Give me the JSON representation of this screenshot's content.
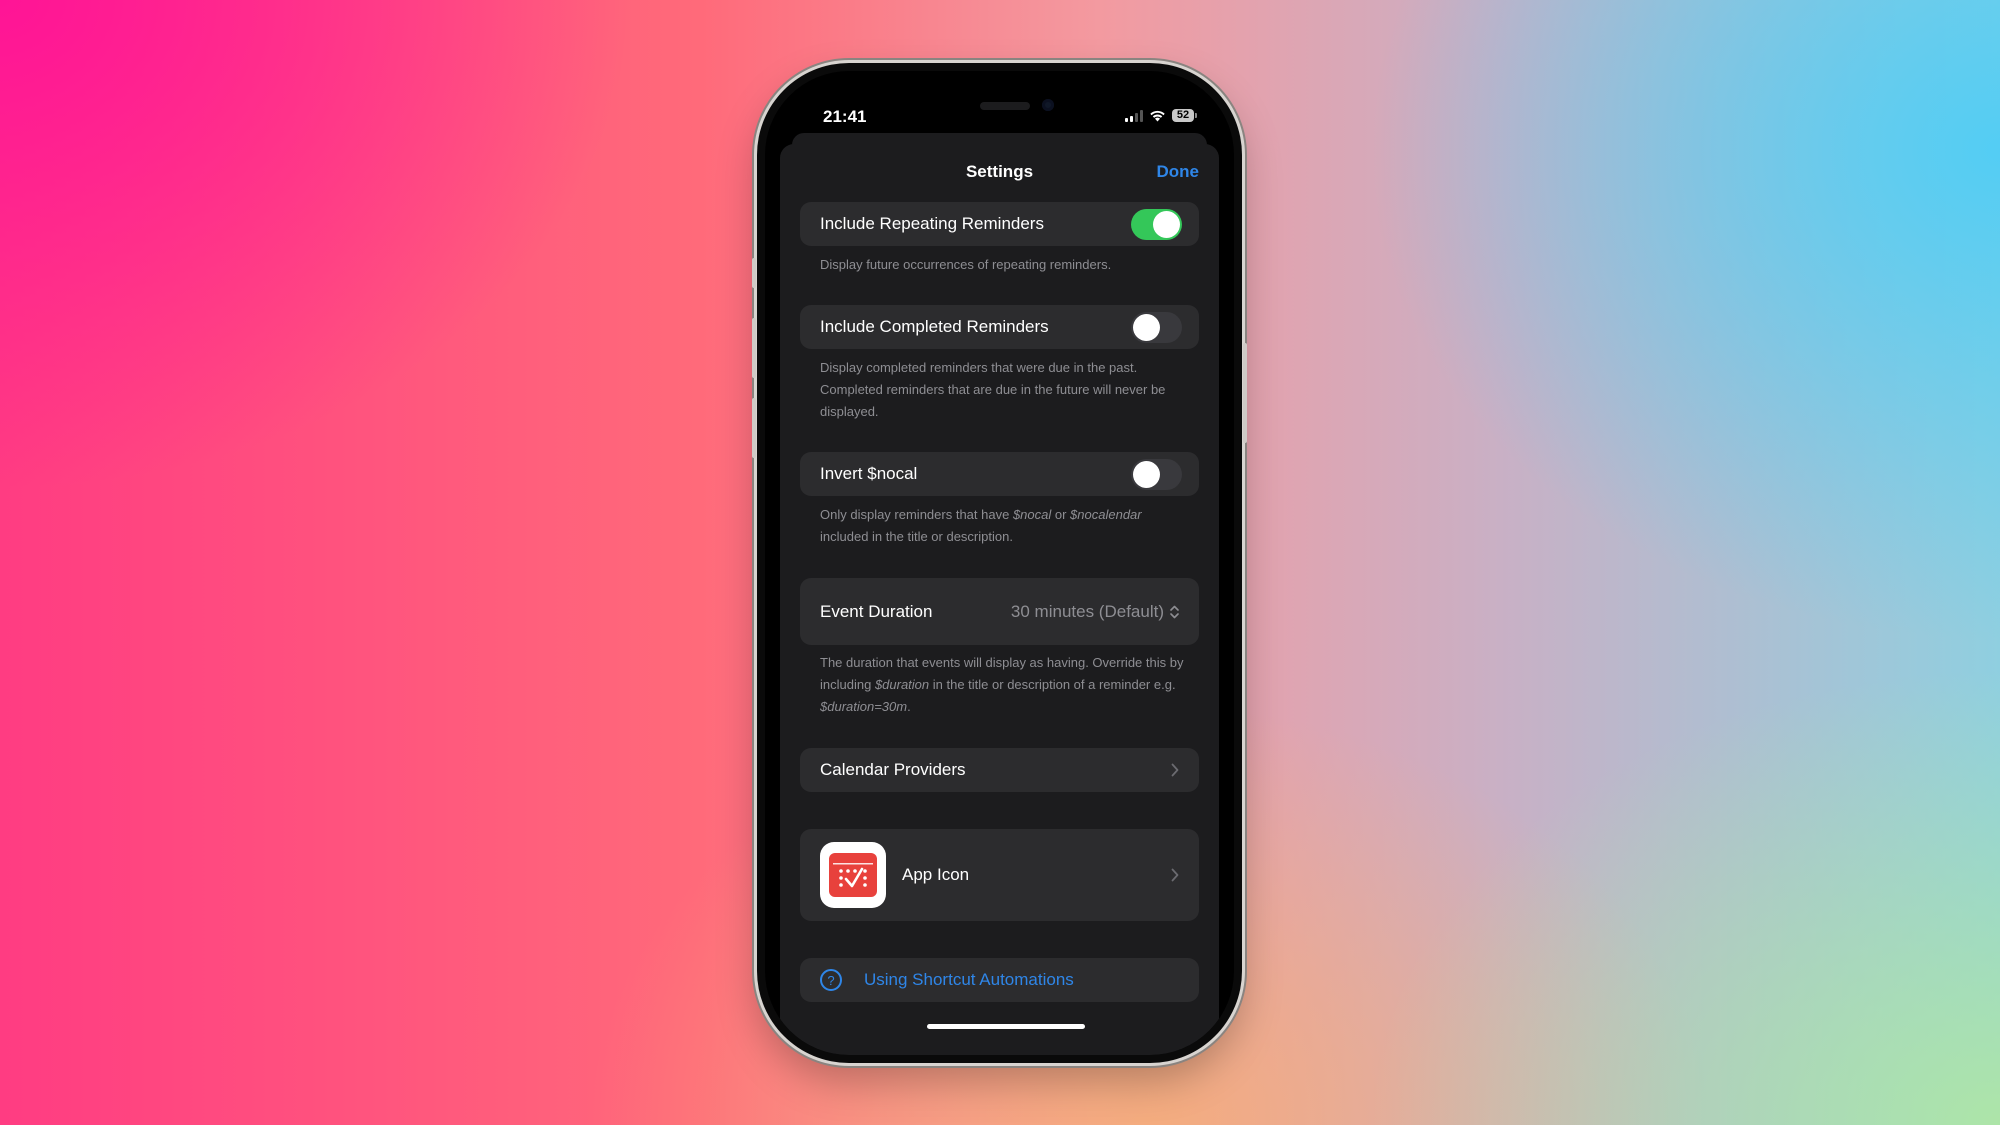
{
  "status_bar": {
    "time": "21:41",
    "battery": "52",
    "signal_bars_active": 2,
    "signal_bars_total": 4
  },
  "sheet": {
    "title": "Settings",
    "done_label": "Done"
  },
  "settings": {
    "repeating": {
      "label": "Include Repeating Reminders",
      "enabled": true,
      "description": "Display future occurrences of repeating reminders."
    },
    "completed": {
      "label": "Include Completed Reminders",
      "enabled": false,
      "description": "Display completed reminders that were due in the past. Completed reminders that are due in the future will never be displayed."
    },
    "invert_nocal": {
      "label": "Invert $nocal",
      "enabled": false,
      "description_parts": [
        "Only display reminders that have ",
        "$nocal",
        " or ",
        "$nocalendar",
        " included in the title or description."
      ]
    },
    "event_duration": {
      "label": "Event Duration",
      "value": "30 minutes (Default)",
      "description_parts": [
        "The duration that events will display as having. Override this by including ",
        "$duration",
        " in the title or description of a reminder e.g. ",
        "$duration=30m",
        "."
      ]
    },
    "calendar_providers": {
      "label": "Calendar Providers"
    },
    "app_icon": {
      "label": "App Icon"
    },
    "shortcut_link": {
      "label": "Using Shortcut Automations"
    }
  },
  "colors": {
    "accent": "#2f86e8",
    "toggle_on": "#34c759",
    "app_icon_red": "#e8413c"
  },
  "icons": {
    "help": "question-circle-icon",
    "chevron": "chevron-right-icon",
    "updown": "chevron-up-down-icon"
  }
}
